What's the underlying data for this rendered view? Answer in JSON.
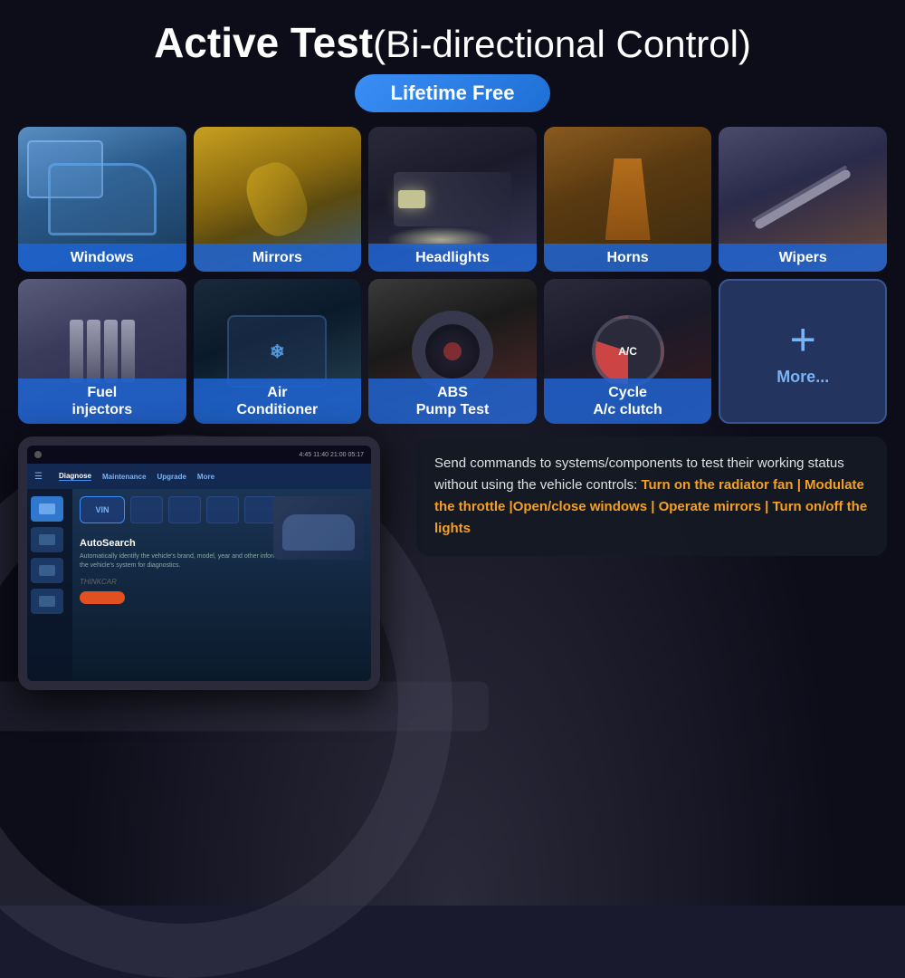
{
  "page": {
    "title_bold": "Active Test",
    "title_normal": "(Bi-directional Control)",
    "badge": "Lifetime Free"
  },
  "row1": [
    {
      "id": "windows",
      "label": "Windows"
    },
    {
      "id": "mirrors",
      "label": "Mirrors"
    },
    {
      "id": "headlights",
      "label": "Headlights"
    },
    {
      "id": "horns",
      "label": "Horns"
    },
    {
      "id": "wipers",
      "label": "Wipers"
    }
  ],
  "row2": [
    {
      "id": "fuel-injectors",
      "label": "Fuel\ninjectors"
    },
    {
      "id": "air-conditioner",
      "label": "Air\nConditioner"
    },
    {
      "id": "abs-pump",
      "label": "ABS\nPump Test"
    },
    {
      "id": "cycle-ac",
      "label": "Cycle\nA/c clutch"
    },
    {
      "id": "more",
      "label": "More..."
    }
  ],
  "tablet": {
    "status": "4:45  11:40  21:00  05:17",
    "nav_items": [
      "Diagnose",
      "Maintenance",
      "Upgrade",
      "More"
    ],
    "active_nav": "Diagnose",
    "vin_label": "VIN",
    "autosearch_label": "AutoSearch",
    "autosearch_desc": "Automatically identify the vehicle's brand, model, year and other information, allowing quick access to the vehicle's system for diagnostics.",
    "brand": "THINKCAR"
  },
  "info": {
    "text_normal": "Send commands to systems/components to test their working status without using the vehicle controls:",
    "text_orange": "Turn on the radiator fan | Modulate the throttle |Open/close windows | Operate mirrors | Turn on/off the lights"
  },
  "more_plus": "+",
  "more_label": "More..."
}
